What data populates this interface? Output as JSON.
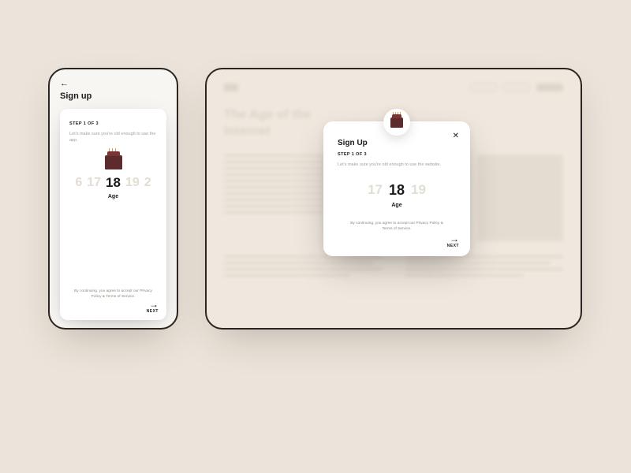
{
  "phone": {
    "title": "Sign up",
    "step": "STEP 1 OF 3",
    "subtitle": "Let's make sure you're old enough to use the app.",
    "age_values": [
      "6",
      "17",
      "18",
      "19",
      "2"
    ],
    "age_selected_index": 2,
    "age_label": "Age",
    "legal": "By continuing, you agree to accept our Privacy Policy & Terms of Service.",
    "next": "NEXT"
  },
  "tablet": {
    "bg_headline": "The Age of the Internet",
    "modal": {
      "title": "Sign Up",
      "step": "STEP 1 OF 3",
      "subtitle": "Let's make sure you're old enough to use the website.",
      "age_values": [
        "17",
        "18",
        "19"
      ],
      "age_selected_index": 1,
      "age_label": "Age",
      "legal": "By continuing, you agree to accept our Privacy Policy & Terms of Service.",
      "next": "NEXT"
    }
  }
}
